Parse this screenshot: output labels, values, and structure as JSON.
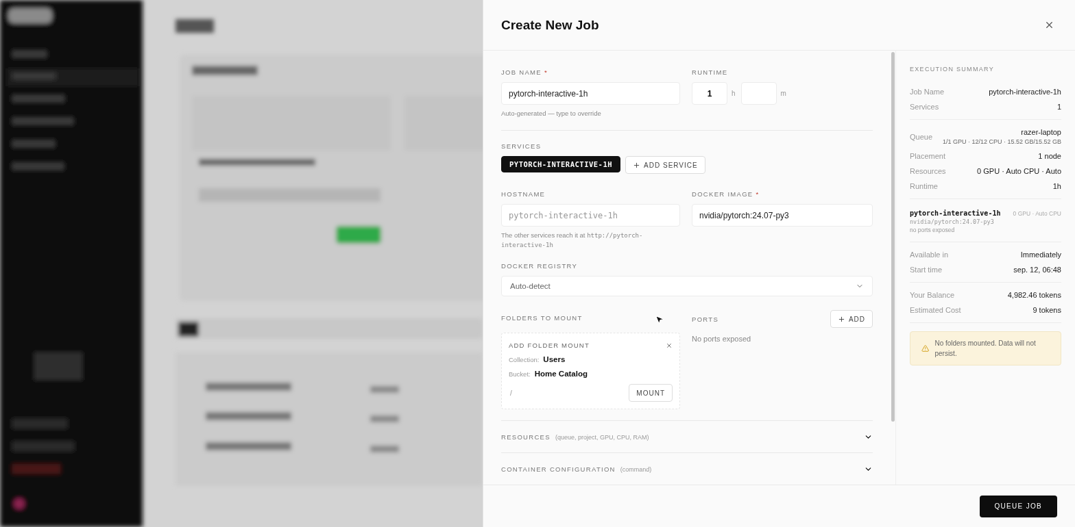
{
  "drawer": {
    "title": "Create New Job"
  },
  "form": {
    "job_name": {
      "label": "JOB NAME",
      "required": true,
      "required_mark": "*",
      "value": "pytorch-interactive-1h",
      "hint": "Auto-generated — type to override"
    },
    "runtime": {
      "label": "RUNTIME",
      "hours": "1",
      "hours_unit": "h",
      "minutes_unit": "m"
    },
    "services": {
      "label": "SERVICES",
      "items": [
        {
          "label": "PYTORCH-INTERACTIVE-1H",
          "selected": true
        }
      ],
      "add_label": "ADD SERVICE"
    },
    "hostname": {
      "label": "HOSTNAME",
      "placeholder": "pytorch-interactive-1h",
      "hint": "The other services reach it at ",
      "hint_code": "http://pytorch-interactive-1h"
    },
    "docker_image": {
      "label": "DOCKER IMAGE",
      "required": true,
      "required_mark": "*",
      "value": "nvidia/pytorch:24.07-py3"
    },
    "docker_registry": {
      "label": "DOCKER REGISTRY",
      "value": "Auto-detect"
    },
    "folders": {
      "label": "FOLDERS TO MOUNT",
      "card": {
        "title": "ADD FOLDER MOUNT",
        "collection_label": "Collection:",
        "collection": "Users",
        "bucket_label": "Bucket:",
        "bucket": "Home Catalog",
        "path": "/",
        "mount_label": "MOUNT"
      }
    },
    "ports": {
      "label": "PORTS",
      "add_label": "ADD",
      "empty": "No ports exposed"
    },
    "sections": [
      {
        "title": "RESOURCES",
        "note": "(queue, project, GPU, CPU, RAM)",
        "expanded": false
      },
      {
        "title": "CONTAINER CONFIGURATION",
        "note": "(command)",
        "expanded": false
      }
    ]
  },
  "summary": {
    "title": "EXECUTION SUMMARY",
    "groups": [
      [
        {
          "label": "Job Name",
          "value": "pytorch-interactive-1h"
        },
        {
          "label": "Services",
          "value": "1"
        }
      ],
      [
        {
          "label": "Queue",
          "value": "razer-laptop",
          "detail": "1/1 GPU · 12/12 CPU · 15.52 GB/15.52 GB"
        },
        {
          "label": "Placement",
          "value": "1 node"
        },
        {
          "label": "Resources",
          "value": "0 GPU · Auto CPU · Auto"
        },
        {
          "label": "Runtime",
          "value": "1h"
        }
      ]
    ],
    "service": {
      "name": "pytorch-interactive-1h",
      "resources": "0 GPU · Auto CPU",
      "image": "nvidia/pytorch:24.07-py3",
      "ports": "no ports exposed"
    },
    "groups_after": [
      [
        {
          "label": "Available in",
          "value": "Immediately"
        },
        {
          "label": "Start time",
          "value": "sep. 12, 06:48"
        }
      ],
      [
        {
          "label": "Your Balance",
          "value": "4,982.46 tokens"
        },
        {
          "label": "Estimated Cost",
          "value": "9 tokens"
        }
      ]
    ],
    "warning": "No folders mounted. Data will not persist."
  },
  "footer": {
    "submit": "QUEUE JOB"
  }
}
